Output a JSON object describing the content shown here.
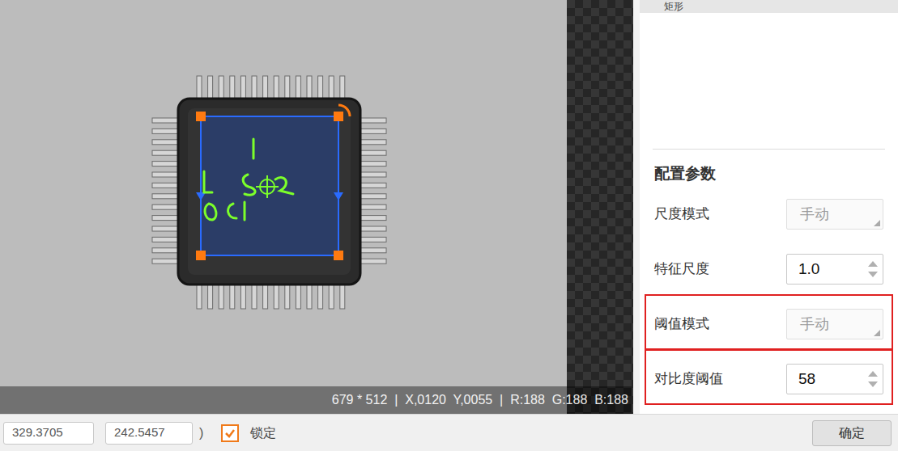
{
  "panel": {
    "title": "矩形",
    "section": "配置参数",
    "params": [
      {
        "label": "尺度模式",
        "kind": "select",
        "value": "手动",
        "disabled": true,
        "highlighted": false
      },
      {
        "label": "特征尺度",
        "kind": "spinner",
        "value": "1.0",
        "disabled": false,
        "highlighted": false
      },
      {
        "label": "阈值模式",
        "kind": "select",
        "value": "手动",
        "disabled": true,
        "highlighted": true
      },
      {
        "label": "对比度阈值",
        "kind": "spinner",
        "value": "58",
        "disabled": false,
        "highlighted": true
      }
    ]
  },
  "status_bar": {
    "text": "679 * 512  |  X,0120  Y,0055  |  R:188  G:188  B:188"
  },
  "footer": {
    "x": "329.3705",
    "y": "242.5457",
    "paren": ")",
    "lock": {
      "label": "锁定",
      "checked": true
    },
    "confirm": "确定"
  }
}
